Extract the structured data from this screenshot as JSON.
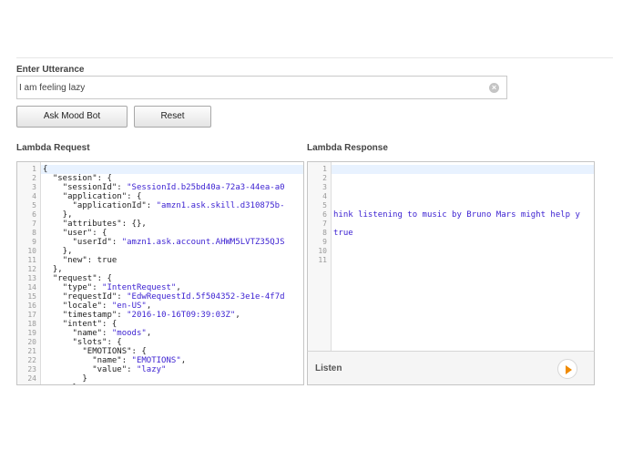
{
  "utterance": {
    "label": "Enter Utterance",
    "value": "I am feeling lazy"
  },
  "buttons": {
    "ask": "Ask Mood Bot",
    "reset": "Reset"
  },
  "request": {
    "label": "Lambda Request",
    "lines": [
      "{",
      "  \"session\": {",
      "    \"sessionId\": \"SessionId.b25bd40a-72a3-44ea-a0",
      "    \"application\": {",
      "      \"applicationId\": \"amzn1.ask.skill.d310875b-",
      "    },",
      "    \"attributes\": {},",
      "    \"user\": {",
      "      \"userId\": \"amzn1.ask.account.AHWM5LVTZ35QJS",
      "    },",
      "    \"new\": true",
      "  },",
      "  \"request\": {",
      "    \"type\": \"IntentRequest\",",
      "    \"requestId\": \"EdwRequestId.5f504352-3e1e-4f7d",
      "    \"locale\": \"en-US\",",
      "    \"timestamp\": \"2016-10-16T09:39:03Z\",",
      "    \"intent\": {",
      "      \"name\": \"moods\",",
      "      \"slots\": {",
      "        \"EMOTIONS\": {",
      "          \"name\": \"EMOTIONS\",",
      "          \"value\": \"lazy\"",
      "        }",
      "      }"
    ]
  },
  "response": {
    "label": "Lambda Response",
    "lines": [
      "",
      "",
      "",
      "",
      "",
      "hink listening to music by Bruno Mars might help y",
      "",
      "true",
      "",
      "",
      ""
    ],
    "listen_label": "Listen"
  },
  "icons": {
    "clear": "clear-icon",
    "play": "play-icon"
  },
  "colors": {
    "accent": "#f08a00",
    "string": "#3a1fd1",
    "active_line": "#e8f2ff"
  }
}
